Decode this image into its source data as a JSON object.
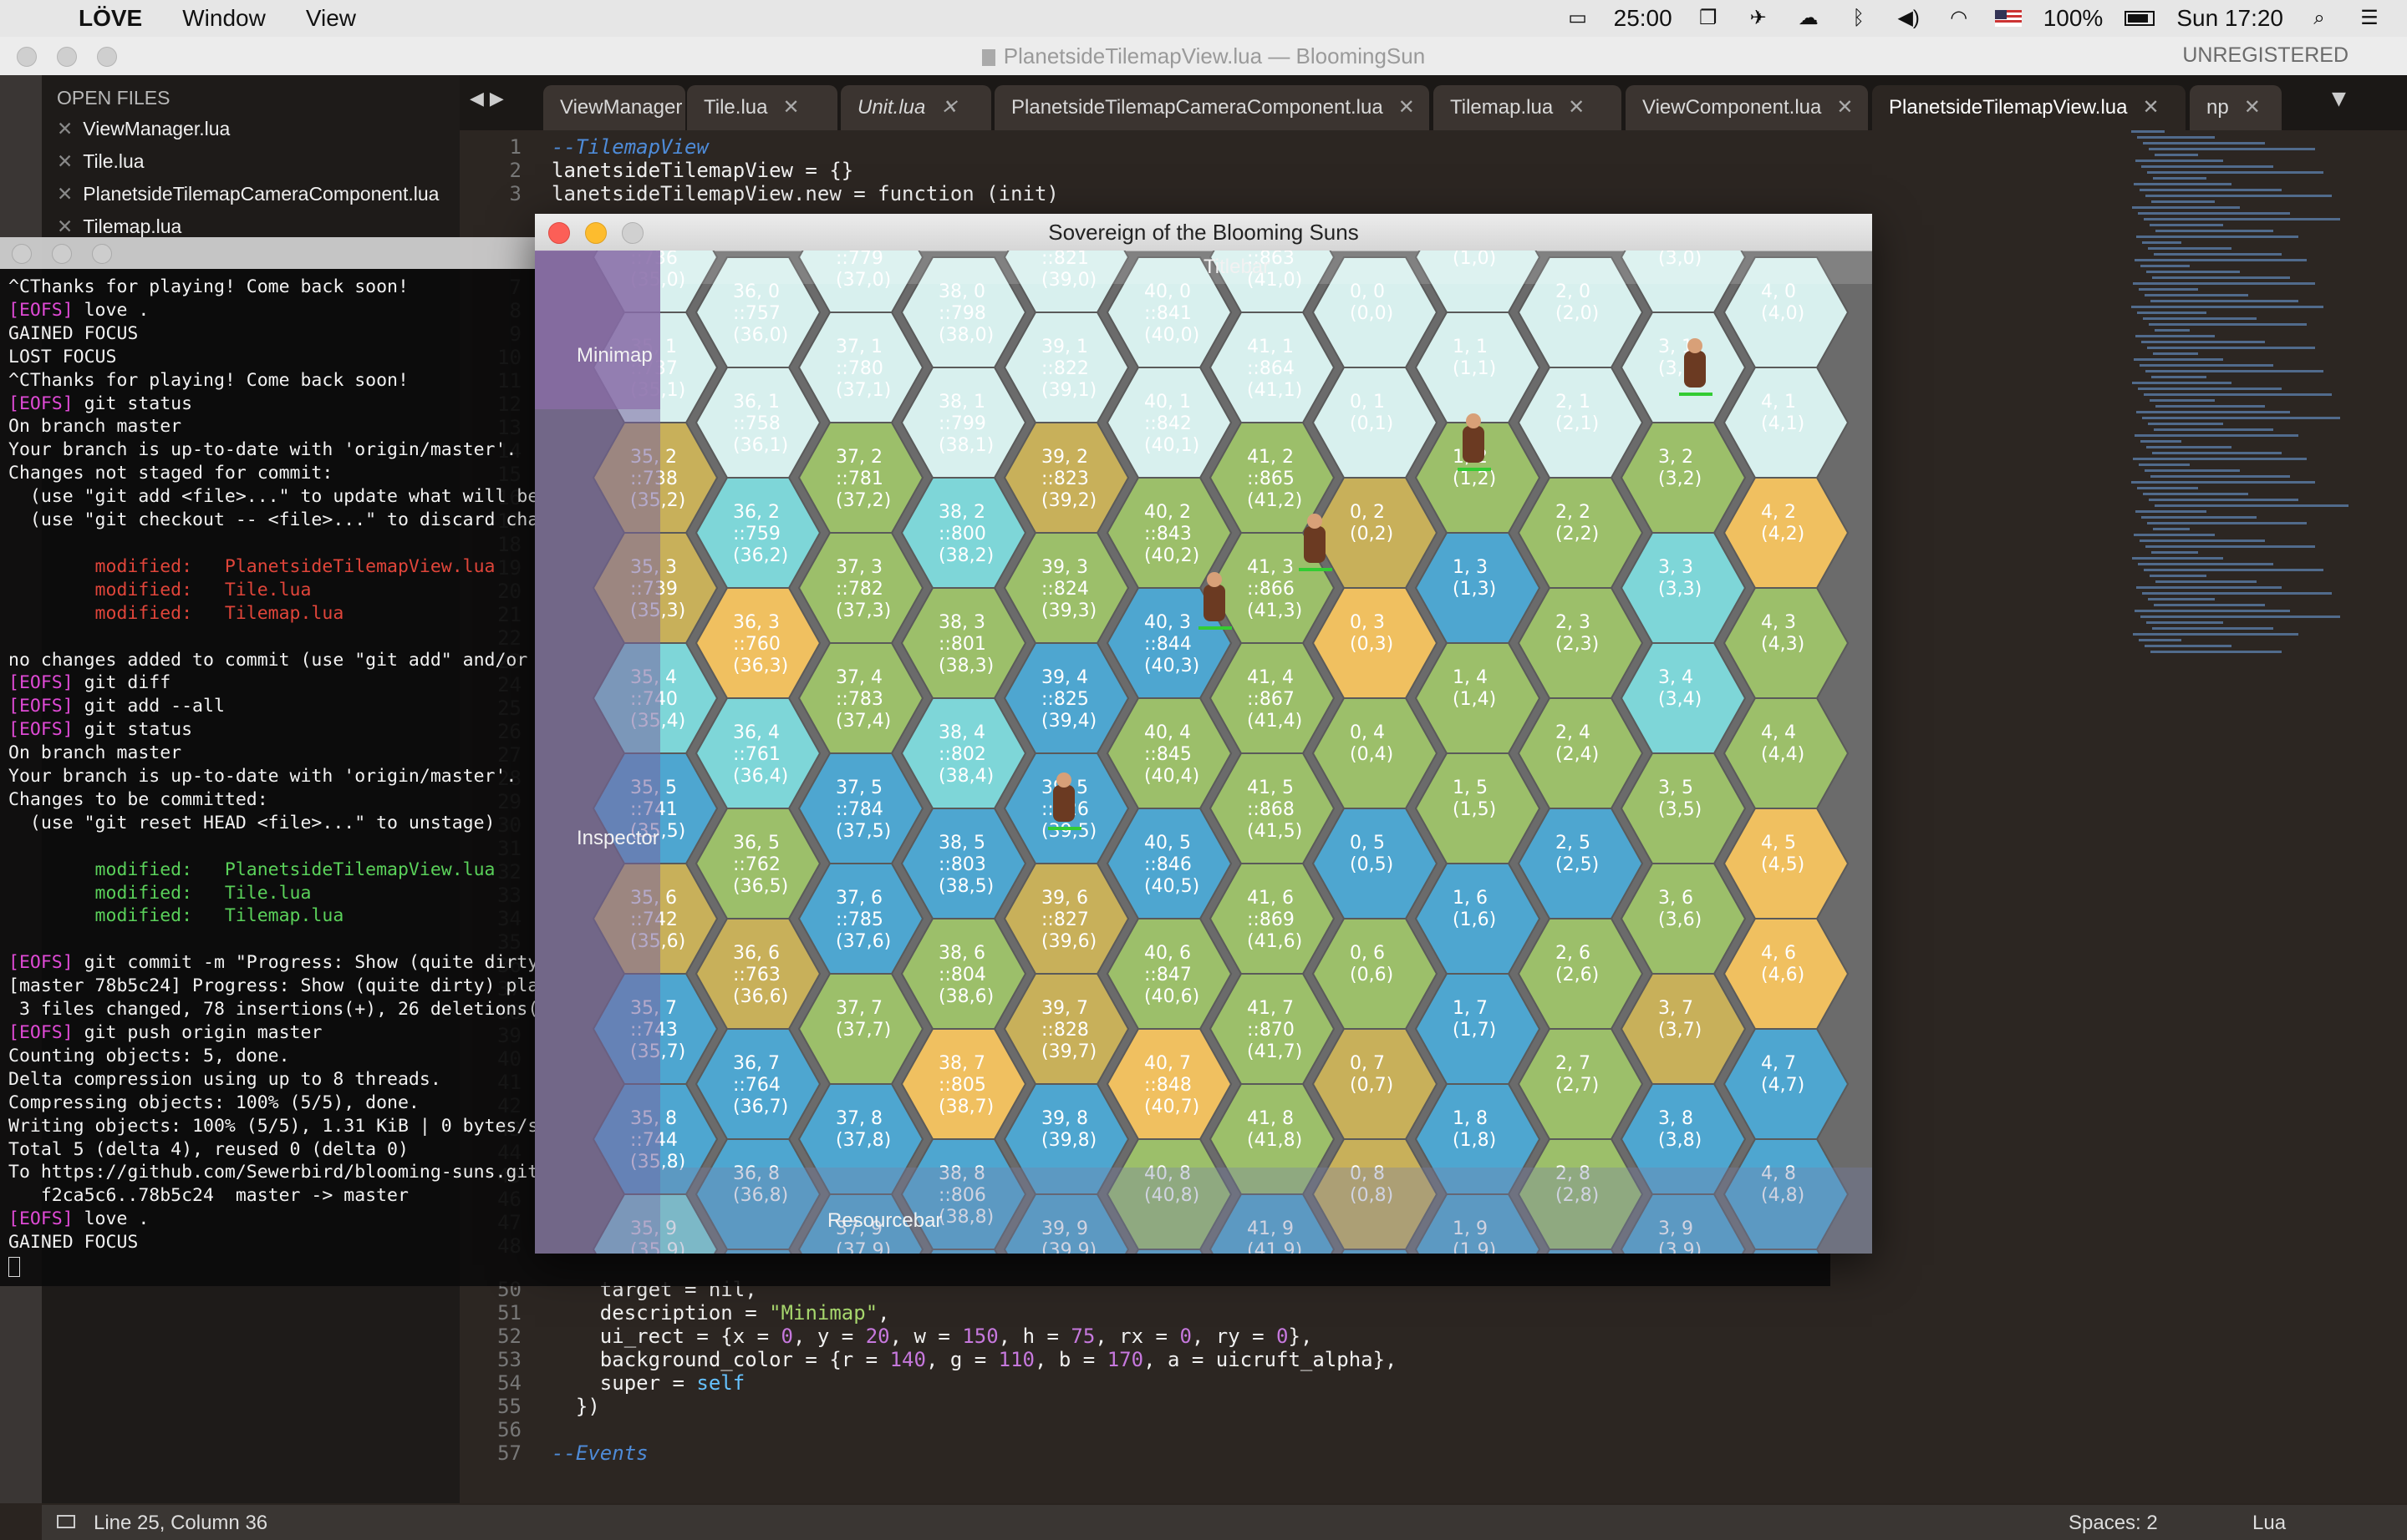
{
  "menubar": {
    "app": "LÖVE",
    "items": [
      "Window",
      "View"
    ],
    "status": {
      "timer": "25:00",
      "battery": "100%",
      "clock": "Sun 17:20"
    }
  },
  "sublime": {
    "title": "PlanetsideTilemapView.lua — BloomingSun",
    "unregistered": "UNREGISTERED",
    "sidebar_header": "OPEN FILES",
    "open_files": [
      "ViewManager.lua",
      "Tile.lua",
      "PlanetsideTilemapCameraComponent.lua",
      "Tilemap.lua"
    ],
    "tabs": [
      "ViewManager",
      "Tile.lua",
      "Unit.lua",
      "PlanetsideTilemapCameraComponent.lua",
      "Tilemap.lua",
      "ViewComponent.lua",
      "PlanetsideTilemapView.lua",
      "np"
    ],
    "active_tab": "PlanetsideTilemapView.lua",
    "code_top": [
      {
        "ln": "1",
        "text": "--TilemapView"
      },
      {
        "ln": "2",
        "text": "lanetsideTilemapView = {}"
      },
      {
        "ln": "3",
        "text": "lanetsideTilemapView.new = function (init)"
      }
    ],
    "code_bottom_lines": [
      "50",
      "51",
      "52",
      "53",
      "54",
      "55",
      "56",
      "57"
    ],
    "code_bottom": {
      "l50": "    target = nil,",
      "l51_key": "    description = ",
      "l51_val": "\"Minimap\"",
      "l52_a": "    ui_rect = {x = ",
      "l52_b": "0",
      "l52_c": ", y = ",
      "l52_d": "20",
      "l52_e": ", w = ",
      "l52_f": "150",
      "l52_g": ", h = ",
      "l52_h": "75",
      "l52_i": ", rx = ",
      "l52_j": "0",
      "l52_k": ", ry = ",
      "l52_l": "0",
      "l52_m": "},",
      "l53_a": "    background_color = {r = ",
      "l53_b": "140",
      "l53_c": ", g = ",
      "l53_d": "110",
      "l53_e": ", b = ",
      "l53_f": "170",
      "l53_g": ", a = uicruft_alpha},",
      "l54_a": "    super = ",
      "l54_b": "self",
      "l55": "  })",
      "l57": "--Events"
    },
    "gutter_mid": [
      "7",
      "8",
      "9",
      "10",
      "11",
      "12",
      "13",
      "14",
      "15",
      "16",
      "17",
      "18",
      "19",
      "20",
      "21",
      "22",
      "23",
      "24",
      "25",
      "26",
      "27",
      "28",
      "29",
      "30",
      "31",
      "32",
      "33",
      "34",
      "35",
      "36",
      "37",
      "38",
      "39",
      "40",
      "41",
      "42",
      "43",
      "44",
      "45",
      "46",
      "47",
      "48"
    ],
    "status_position": "Line 25, Column 36",
    "status_spaces": "Spaces: 2",
    "status_lang": "Lua"
  },
  "terminal": {
    "lines": [
      {
        "t": "^CThanks for playing! Come back soon!"
      },
      {
        "p": "[EOFS]",
        "t": " love ."
      },
      {
        "t": "GAINED FOCUS"
      },
      {
        "t": "LOST FOCUS"
      },
      {
        "t": "^CThanks for playing! Come back soon!"
      },
      {
        "p": "[EOFS]",
        "t": " git status"
      },
      {
        "t": "On branch master"
      },
      {
        "t": "Your branch is up-to-date with 'origin/master'."
      },
      {
        "t": "Changes not staged for commit:"
      },
      {
        "t": "  (use \"git add <file>...\" to update what will be com"
      },
      {
        "t": "  (use \"git checkout -- <file>...\" to discard changes"
      },
      {
        "t": ""
      },
      {
        "m": "        modified:   PlanetsideTilemapView.lua"
      },
      {
        "m": "        modified:   Tile.lua"
      },
      {
        "m": "        modified:   Tilemap.lua"
      },
      {
        "t": ""
      },
      {
        "t": "no changes added to commit (use \"git add\" and/or \"git"
      },
      {
        "p": "[EOFS]",
        "t": " git diff"
      },
      {
        "p": "[EOFS]",
        "t": " git add --all"
      },
      {
        "p": "[EOFS]",
        "t": " git status"
      },
      {
        "t": "On branch master"
      },
      {
        "t": "Your branch is up-to-date with 'origin/master'."
      },
      {
        "t": "Changes to be committed:"
      },
      {
        "t": "  (use \"git reset HEAD <file>...\" to unstage)"
      },
      {
        "t": ""
      },
      {
        "s": "        modified:   PlanetsideTilemapView.lua"
      },
      {
        "s": "        modified:   Tile.lua"
      },
      {
        "s": "        modified:   Tilemap.lua"
      },
      {
        "t": ""
      },
      {
        "p": "[EOFS]",
        "t": " git commit -m \"Progress: Show (quite dirty) pl"
      },
      {
        "t": "[master 78b5c24] Progress: Show (quite dirty) planets"
      },
      {
        "t": " 3 files changed, 78 insertions(+), 26 deletions(-)"
      },
      {
        "p": "[EOFS]",
        "t": " git push origin master"
      },
      {
        "t": "Counting objects: 5, done."
      },
      {
        "t": "Delta compression using up to 8 threads."
      },
      {
        "t": "Compressing objects: 100% (5/5), done."
      },
      {
        "t": "Writing objects: 100% (5/5), 1.31 KiB | 0 bytes/s, do"
      },
      {
        "t": "Total 5 (delta 4), reused 0 (delta 0)"
      },
      {
        "t": "To https://github.com/Sewerbird/blooming-suns.git"
      },
      {
        "t": "   f2ca5c6..78b5c24  master -> master"
      },
      {
        "p": "[EOFS]",
        "t": " love ."
      },
      {
        "t": "GAINED FOCUS"
      }
    ]
  },
  "game": {
    "title": "Sovereign of the Blooming Suns",
    "labels": {
      "titlebar": "Titlebar",
      "minimap": "Minimap",
      "inspector": "Inspector",
      "resourcebar": "Resourcebar"
    },
    "colors": {
      "snow": "#d8f0ee",
      "grass": "#9cbf6a",
      "desert": "#c8b05a",
      "sand": "#f0c060",
      "water": "#4ea6d0",
      "ice": "#7ed6d8",
      "tundra": "#b9c98a"
    },
    "columns": [
      "35",
      "36",
      "37",
      "38",
      "39",
      "40",
      "41",
      "0",
      "1",
      "2",
      "3",
      "4"
    ],
    "rows": [
      "0",
      "1",
      "2",
      "3",
      "4",
      "5",
      "6",
      "7",
      "8",
      "9"
    ],
    "ids": {
      "35": [
        "736",
        "737",
        "738",
        "739",
        "740",
        "741",
        "742",
        "743",
        "744"
      ],
      "36": [
        "757",
        "758",
        "759",
        "760",
        "761",
        "762",
        "763",
        "764"
      ],
      "37": [
        "779",
        "780",
        "781",
        "782",
        "783",
        "784",
        "785"
      ],
      "38": [
        "798",
        "799",
        "800",
        "801",
        "802",
        "803",
        "804",
        "805",
        "806"
      ],
      "39": [
        "821",
        "822",
        "823",
        "824",
        "825",
        "826",
        "827",
        "828"
      ],
      "40": [
        "841",
        "842",
        "843",
        "844",
        "845",
        "846",
        "847",
        "848"
      ],
      "41": [
        "863",
        "864",
        "865",
        "866",
        "867",
        "868",
        "869",
        "870"
      ]
    }
  }
}
